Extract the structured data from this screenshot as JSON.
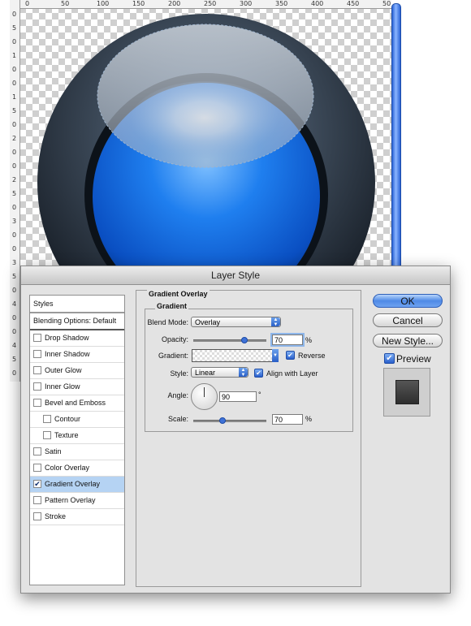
{
  "canvas": {
    "ruler_h_ticks": [
      "0",
      "50",
      "100",
      "150",
      "200",
      "250",
      "300",
      "350",
      "400",
      "450",
      "50"
    ],
    "ruler_v_ticks": [
      "0",
      "5",
      "0",
      "1",
      "0",
      "0",
      "1",
      "5",
      "0",
      "2",
      "0",
      "0",
      "2",
      "5",
      "0",
      "3",
      "0",
      "0",
      "3",
      "5",
      "0",
      "4",
      "0",
      "0",
      "4",
      "5",
      "0"
    ]
  },
  "dialog": {
    "title": "Layer Style",
    "styles_header": "Styles",
    "blending_options": "Blending Options: Default",
    "style_items": [
      {
        "label": "Drop Shadow",
        "checked": false,
        "sub": false
      },
      {
        "label": "Inner Shadow",
        "checked": false,
        "sub": false
      },
      {
        "label": "Outer Glow",
        "checked": false,
        "sub": false
      },
      {
        "label": "Inner Glow",
        "checked": false,
        "sub": false
      },
      {
        "label": "Bevel and Emboss",
        "checked": false,
        "sub": false
      },
      {
        "label": "Contour",
        "checked": false,
        "sub": true
      },
      {
        "label": "Texture",
        "checked": false,
        "sub": true
      },
      {
        "label": "Satin",
        "checked": false,
        "sub": false
      },
      {
        "label": "Color Overlay",
        "checked": false,
        "sub": false
      },
      {
        "label": "Gradient Overlay",
        "checked": true,
        "sub": false,
        "selected": true
      },
      {
        "label": "Pattern Overlay",
        "checked": false,
        "sub": false
      },
      {
        "label": "Stroke",
        "checked": false,
        "sub": false
      }
    ],
    "section_title": "Gradient Overlay",
    "group_title": "Gradient",
    "blend_mode_label": "Blend Mode:",
    "blend_mode_value": "Overlay",
    "opacity_label": "Opacity:",
    "opacity_value": "70",
    "opacity_level": 0.7,
    "percent": "%",
    "gradient_label": "Gradient:",
    "reverse_label": "Reverse",
    "reverse_checked": true,
    "style_label": "Style:",
    "style_value": "Linear",
    "align_label": "Align with Layer",
    "align_checked": true,
    "angle_label": "Angle:",
    "angle_value": "90",
    "degree": "°",
    "scale_label": "Scale:",
    "scale_value": "70",
    "scale_level": 0.4,
    "ok_label": "OK",
    "cancel_label": "Cancel",
    "new_style_label": "New Style...",
    "preview_label": "Preview",
    "preview_checked": true
  },
  "colors": {
    "accent_blue": "#2a60cc",
    "selection": "#b5d3f3",
    "orb_blue": "#1f6fe0",
    "orb_ring": "#2b3440"
  }
}
